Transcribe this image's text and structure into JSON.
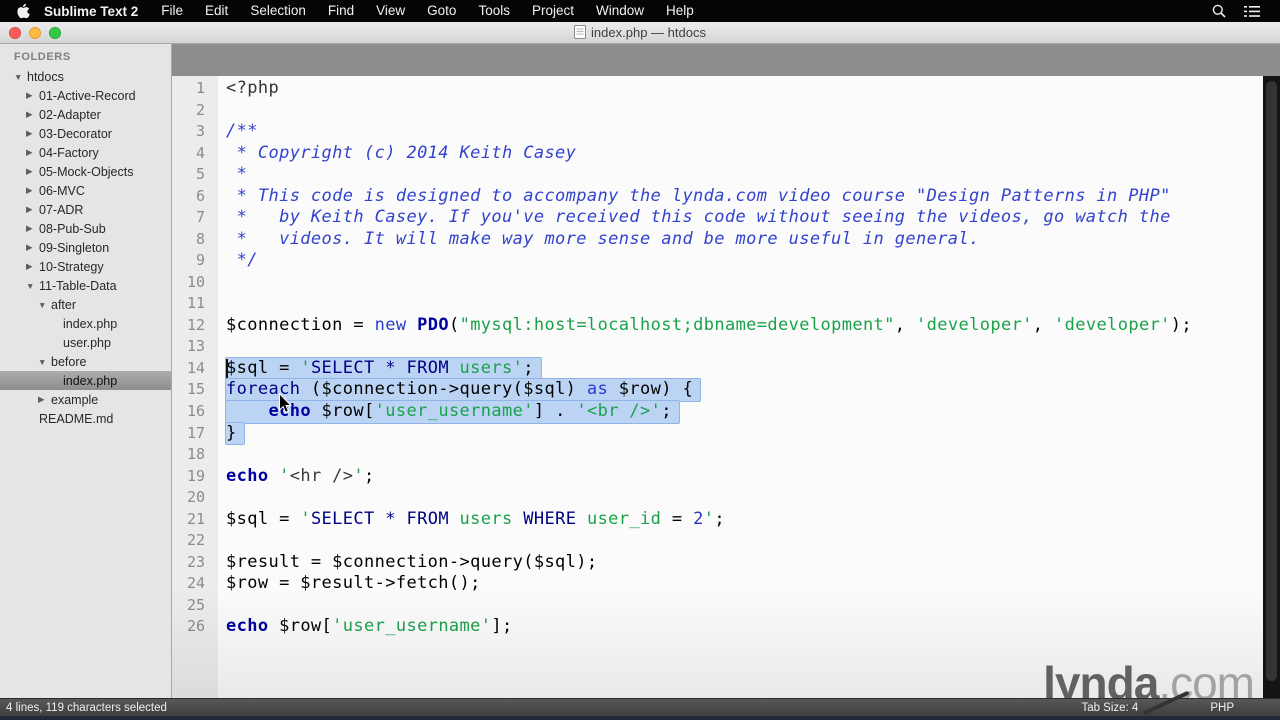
{
  "menu_bar": {
    "app_name": "Sublime Text 2",
    "items": [
      "File",
      "Edit",
      "Selection",
      "Find",
      "View",
      "Goto",
      "Tools",
      "Project",
      "Window",
      "Help"
    ],
    "right_icons": [
      "spotlight-search-icon",
      "notification-center-icon"
    ]
  },
  "title_bar": {
    "title": "index.php — htdocs"
  },
  "sidebar": {
    "header": "FOLDERS",
    "items": [
      {
        "label": "htdocs",
        "level": 0,
        "arrow": "down",
        "selected": false
      },
      {
        "label": "01-Active-Record",
        "level": 1,
        "arrow": "right",
        "selected": false
      },
      {
        "label": "02-Adapter",
        "level": 1,
        "arrow": "right",
        "selected": false
      },
      {
        "label": "03-Decorator",
        "level": 1,
        "arrow": "right",
        "selected": false
      },
      {
        "label": "04-Factory",
        "level": 1,
        "arrow": "right",
        "selected": false
      },
      {
        "label": "05-Mock-Objects",
        "level": 1,
        "arrow": "right",
        "selected": false
      },
      {
        "label": "06-MVC",
        "level": 1,
        "arrow": "right",
        "selected": false
      },
      {
        "label": "07-ADR",
        "level": 1,
        "arrow": "right",
        "selected": false
      },
      {
        "label": "08-Pub-Sub",
        "level": 1,
        "arrow": "right",
        "selected": false
      },
      {
        "label": "09-Singleton",
        "level": 1,
        "arrow": "right",
        "selected": false
      },
      {
        "label": "10-Strategy",
        "level": 1,
        "arrow": "right",
        "selected": false
      },
      {
        "label": "11-Table-Data",
        "level": 1,
        "arrow": "down",
        "selected": false
      },
      {
        "label": "after",
        "level": 2,
        "arrow": "down",
        "selected": false
      },
      {
        "label": "index.php",
        "level": 3,
        "arrow": "none",
        "selected": false
      },
      {
        "label": "user.php",
        "level": 3,
        "arrow": "none",
        "selected": false
      },
      {
        "label": "before",
        "level": 2,
        "arrow": "down",
        "selected": false
      },
      {
        "label": "index.php",
        "level": 3,
        "arrow": "none",
        "selected": true
      },
      {
        "label": "example",
        "level": 2,
        "arrow": "right",
        "selected": false
      },
      {
        "label": "README.md",
        "level": 1,
        "arrow": "none",
        "selected": false
      }
    ]
  },
  "editor": {
    "lines": [
      {
        "num": 1,
        "selected": false,
        "segs": [
          [
            "<?php",
            "tg"
          ]
        ]
      },
      {
        "num": 2,
        "selected": false,
        "segs": []
      },
      {
        "num": 3,
        "selected": false,
        "segs": [
          [
            "/**",
            "cm"
          ]
        ]
      },
      {
        "num": 4,
        "selected": false,
        "segs": [
          [
            " * Copyright (c) 2014 Keith Casey",
            "cm"
          ]
        ]
      },
      {
        "num": 5,
        "selected": false,
        "segs": [
          [
            " *",
            "cm"
          ]
        ]
      },
      {
        "num": 6,
        "selected": false,
        "segs": [
          [
            " * This code is designed to accompany the lynda.com video course \"Design Patterns in PHP\"",
            "cm"
          ]
        ]
      },
      {
        "num": 7,
        "selected": false,
        "segs": [
          [
            " *   by Keith Casey. If you've received this code without seeing the videos, go watch the",
            "cm"
          ]
        ]
      },
      {
        "num": 8,
        "selected": false,
        "segs": [
          [
            " *   videos. It will make way more sense and be more useful in general.",
            "cm"
          ]
        ]
      },
      {
        "num": 9,
        "selected": false,
        "segs": [
          [
            " */",
            "cm"
          ]
        ]
      },
      {
        "num": 10,
        "selected": false,
        "segs": []
      },
      {
        "num": 11,
        "selected": false,
        "segs": []
      },
      {
        "num": 12,
        "selected": false,
        "segs": [
          [
            "$connection = ",
            "p"
          ],
          [
            "new",
            "kw"
          ],
          [
            " ",
            "p"
          ],
          [
            "PDO",
            "kb"
          ],
          [
            "(",
            "p"
          ],
          [
            "\"mysql:host=localhost;dbname=development\"",
            "st"
          ],
          [
            ", ",
            "p"
          ],
          [
            "'developer'",
            "st"
          ],
          [
            ", ",
            "p"
          ],
          [
            "'developer'",
            "st"
          ],
          [
            ");",
            "p"
          ]
        ]
      },
      {
        "num": 13,
        "selected": false,
        "segs": []
      },
      {
        "num": 14,
        "selected": true,
        "caret": true,
        "segs": [
          [
            "$sql = ",
            "p"
          ],
          [
            "'",
            "st"
          ],
          [
            "SELECT * FROM ",
            "sq"
          ],
          [
            "users'",
            "st"
          ],
          [
            ";",
            "p"
          ]
        ]
      },
      {
        "num": 15,
        "selected": true,
        "segs": [
          [
            "foreach",
            "ct"
          ],
          [
            " ($connection->query($sql) ",
            "p"
          ],
          [
            "as",
            "kw"
          ],
          [
            " $row) {",
            "p"
          ]
        ]
      },
      {
        "num": 16,
        "selected": true,
        "segs": [
          [
            "    ",
            "p"
          ],
          [
            "echo",
            "kb"
          ],
          [
            " $row[",
            "p"
          ],
          [
            "'user_username'",
            "st"
          ],
          [
            "] . ",
            "p"
          ],
          [
            "'<br />'",
            "st"
          ],
          [
            ";",
            "p"
          ]
        ]
      },
      {
        "num": 17,
        "selected": true,
        "segs": [
          [
            "}",
            "p"
          ]
        ]
      },
      {
        "num": 18,
        "selected": false,
        "segs": []
      },
      {
        "num": 19,
        "selected": false,
        "segs": [
          [
            "echo",
            "kb"
          ],
          [
            " ",
            "p"
          ],
          [
            "'",
            "st"
          ],
          [
            "<hr />",
            "hs"
          ],
          [
            "'",
            "st"
          ],
          [
            ";",
            "p"
          ]
        ]
      },
      {
        "num": 20,
        "selected": false,
        "segs": []
      },
      {
        "num": 21,
        "selected": false,
        "segs": [
          [
            "$sql = ",
            "p"
          ],
          [
            "'",
            "st"
          ],
          [
            "SELECT * FROM ",
            "sq"
          ],
          [
            "users",
            "st"
          ],
          [
            " ",
            "p"
          ],
          [
            "WHERE",
            "sq"
          ],
          [
            " ",
            "p"
          ],
          [
            "user_id",
            "st"
          ],
          [
            " = ",
            "p"
          ],
          [
            "2",
            "nm"
          ],
          [
            "'",
            "st"
          ],
          [
            ";",
            "p"
          ]
        ]
      },
      {
        "num": 22,
        "selected": false,
        "segs": []
      },
      {
        "num": 23,
        "selected": false,
        "segs": [
          [
            "$result = $connection->query($sql);",
            "p"
          ]
        ]
      },
      {
        "num": 24,
        "selected": false,
        "segs": [
          [
            "$row = $result->fetch();",
            "p"
          ]
        ]
      },
      {
        "num": 25,
        "selected": false,
        "segs": []
      },
      {
        "num": 26,
        "selected": false,
        "segs": [
          [
            "echo",
            "kb"
          ],
          [
            " $row[",
            "p"
          ],
          [
            "'user_username'",
            "st"
          ],
          [
            "];",
            "p"
          ]
        ]
      }
    ]
  },
  "status_bar": {
    "left": "4 lines, 119 characters selected",
    "tab_size": "Tab Size: 4",
    "syntax": "PHP"
  },
  "watermark": {
    "name": "lynda",
    "tld": ".com"
  },
  "colors": {
    "selection": "#bcd4f4",
    "selection_border": "#8fb4e5",
    "string_green": "#1aa14a",
    "keyword_blue": "#2a3cd0",
    "keyword_bold_navy": "#0000a0",
    "comment_blue": "#3243cc",
    "sql_keyword_navy": "#000082",
    "sidebar_bg": "#e5e5e5",
    "statusbar_bg": "#4a4a4a"
  }
}
